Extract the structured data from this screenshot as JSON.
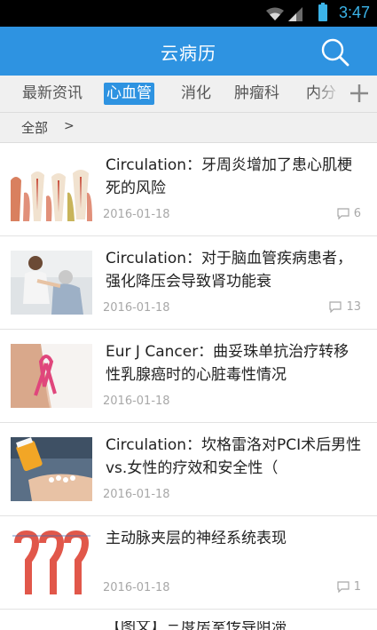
{
  "status_bar": {
    "time": "3:47"
  },
  "header": {
    "title": "云病历"
  },
  "tabs": [
    {
      "label": "最新资讯",
      "active": false
    },
    {
      "label": "心血管",
      "active": true
    },
    {
      "label": "消化",
      "active": false
    },
    {
      "label": "肿瘤科",
      "active": false
    },
    {
      "label": "内分",
      "active": false
    }
  ],
  "filter": {
    "label": "全部",
    "arrow": ">"
  },
  "articles": [
    {
      "title": "Circulation：牙周炎增加了患心肌梗死的风险",
      "date": "2016-01-18",
      "comments": "6"
    },
    {
      "title": "Circulation：对于脑血管疾病患者，强化降压会导致肾功能衰",
      "date": "2016-01-18",
      "comments": "13"
    },
    {
      "title": "Eur J Cancer：曲妥珠单抗治疗转移性乳腺癌时的心脏毒性情况",
      "date": "2016-01-18",
      "comments": ""
    },
    {
      "title": "Circulation：坎格雷洛对PCI术后男性vs.女性的疗效和安全性（",
      "date": "2016-01-18",
      "comments": ""
    },
    {
      "title": "主动脉夹层的神经系统表现",
      "date": "2016-01-18",
      "comments": "1"
    }
  ],
  "peek_item": {
    "title": "【图文】三度房室传导阻滞"
  },
  "colors": {
    "primary": "#2e93e1",
    "status_accent": "#3bb3e8",
    "tab_bg": "#f0f0f0",
    "meta_text": "#a8a8a8"
  },
  "icons": {
    "search": "search-icon",
    "add_tab": "plus-icon",
    "comment": "comment-icon"
  }
}
